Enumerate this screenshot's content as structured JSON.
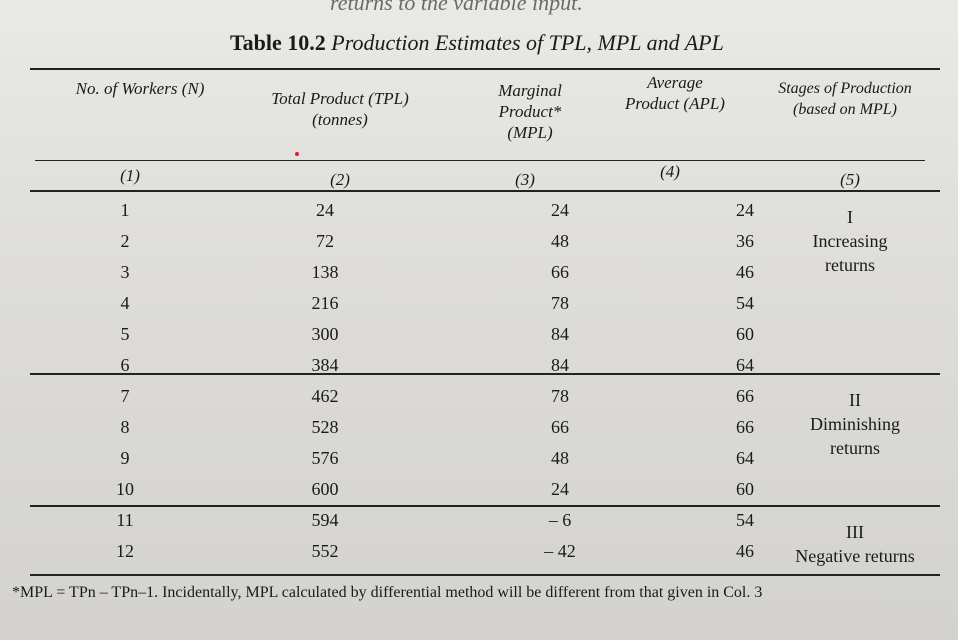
{
  "top_fragment": "returns to the variable input.",
  "title": {
    "label": "Table 10.2",
    "text": "Production Estimates of TPL, MPL and APL"
  },
  "headers": {
    "col1": "No. of Workers (N)",
    "col2": "Total Product (TPL) (tonnes)",
    "col3": "Marginal Product* (MPL)",
    "col4": "Average Product (APL)",
    "col5": "Stages of Production (based on MPL)"
  },
  "column_numbers": [
    "(1)",
    "(2)",
    "(3)",
    "(4)",
    "(5)"
  ],
  "rows": [
    {
      "n": "1",
      "tp": "24",
      "mp": "24",
      "ap": "24"
    },
    {
      "n": "2",
      "tp": "72",
      "mp": "48",
      "ap": "36"
    },
    {
      "n": "3",
      "tp": "138",
      "mp": "66",
      "ap": "46"
    },
    {
      "n": "4",
      "tp": "216",
      "mp": "78",
      "ap": "54"
    },
    {
      "n": "5",
      "tp": "300",
      "mp": "84",
      "ap": "60"
    },
    {
      "n": "6",
      "tp": "384",
      "mp": "84",
      "ap": "64"
    },
    {
      "n": "7",
      "tp": "462",
      "mp": "78",
      "ap": "66"
    },
    {
      "n": "8",
      "tp": "528",
      "mp": "66",
      "ap": "66"
    },
    {
      "n": "9",
      "tp": "576",
      "mp": "48",
      "ap": "64"
    },
    {
      "n": "10",
      "tp": "600",
      "mp": "24",
      "ap": "60"
    },
    {
      "n": "11",
      "tp": "594",
      "mp": "– 6",
      "ap": "54"
    },
    {
      "n": "12",
      "tp": "552",
      "mp": "– 42",
      "ap": "46"
    }
  ],
  "stages": [
    {
      "numeral": "I",
      "label": "Increasing returns"
    },
    {
      "numeral": "II",
      "label": "Diminishing returns"
    },
    {
      "numeral": "III",
      "label": "Negative returns"
    }
  ],
  "footnote": "*MPL = TPn – TPn–1. Incidentally, MPL calculated by differential method will be different from that given in Col. 3"
}
